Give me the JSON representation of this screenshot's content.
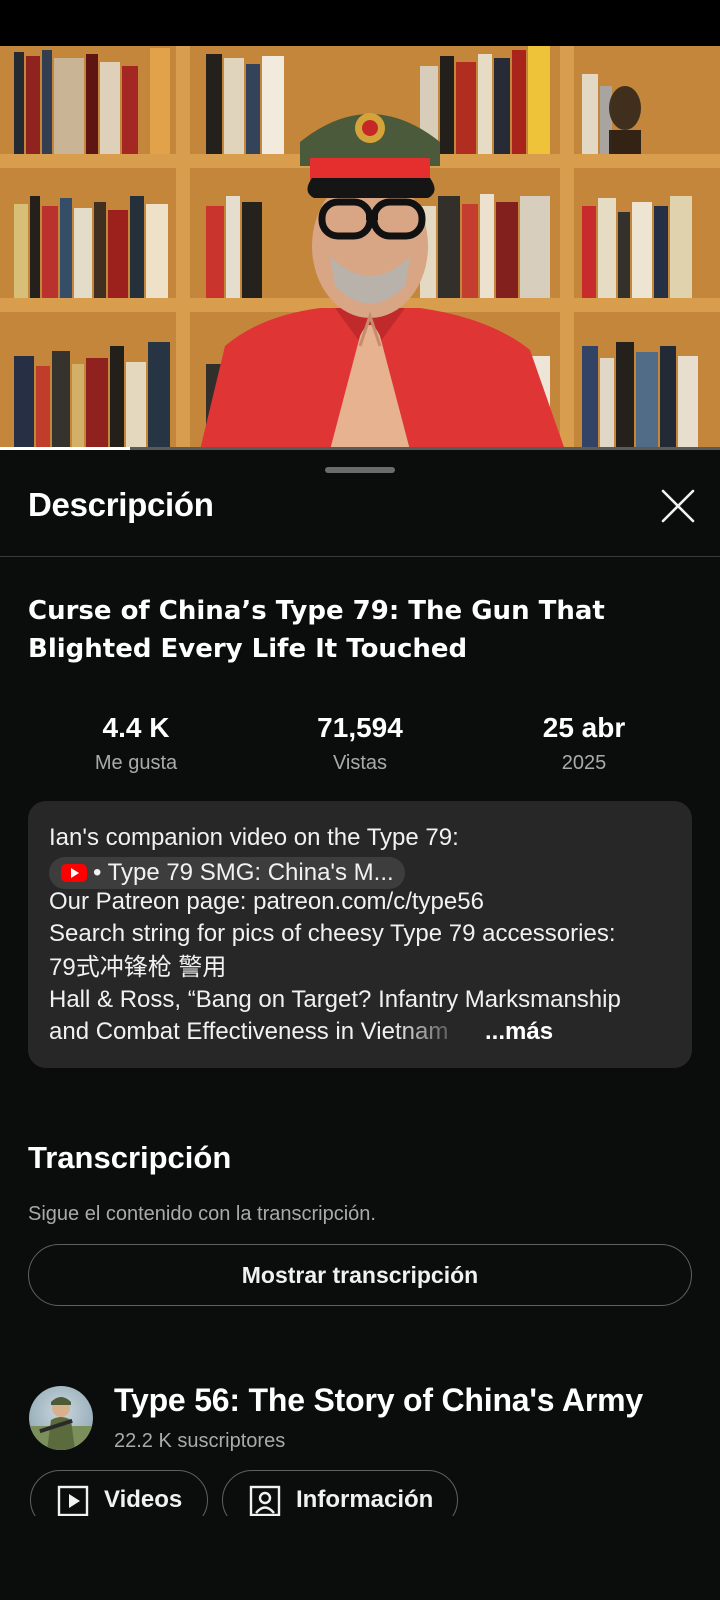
{
  "video": {
    "progress_fraction": 0.18
  },
  "sheet": {
    "title": "Descripción",
    "close_label": "Cerrar"
  },
  "video_info": {
    "title_line1": "Curse of China’s Type 79: The Gun That",
    "title_line2": "Blighted Every Life It Touched"
  },
  "stats": [
    {
      "value": "4.4 K",
      "label": "Me gusta"
    },
    {
      "value": "71,594",
      "label": "Vistas"
    },
    {
      "value": "25 abr",
      "label": "2025"
    }
  ],
  "description": {
    "line1": "Ian's companion video on the Type 79:",
    "chip_text": "• Type 79 SMG: China's M...",
    "line3": "Our Patreon page: patreon.com/c/type56",
    "line4": "Search string for pics of cheesy Type 79 accessories:",
    "line5": "79式冲锋枪  警用",
    "line6": "Hall & Ross, “Bang on Target? Infantry Marksmanship",
    "line7": "and Combat Effectiveness in Vietnam",
    "more_label": "...más"
  },
  "transcript": {
    "title": "Transcripción",
    "subtitle": "Sigue el contenido con la transcripción.",
    "button_label": "Mostrar transcripción"
  },
  "channel": {
    "name": "Type 56: The Story of China's Army",
    "subscribers": "22.2 K suscriptores",
    "videos_label": "Videos",
    "about_label": "Información"
  }
}
